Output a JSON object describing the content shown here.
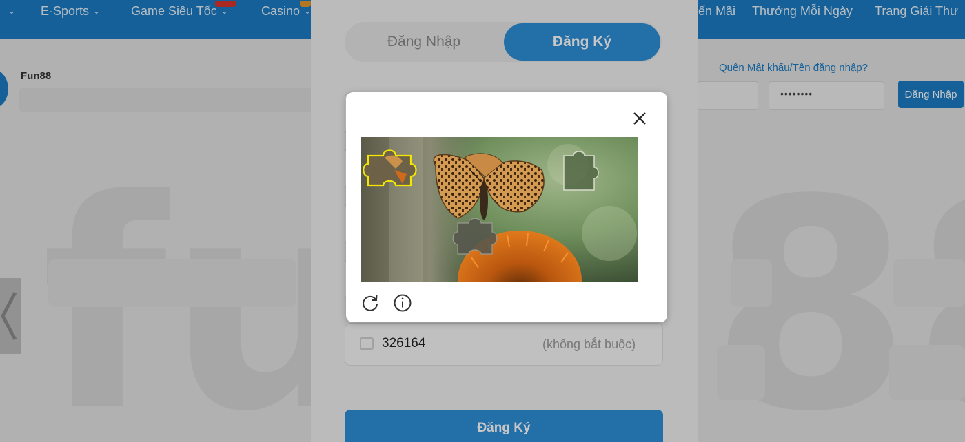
{
  "nav": {
    "items": [
      {
        "label": "o",
        "chevron": true
      },
      {
        "label": "E-Sports",
        "chevron": true
      },
      {
        "label": "Game Siêu Tốc",
        "chevron": true
      },
      {
        "label": "Casino",
        "chevron": true
      },
      {
        "label": "ến Mãi",
        "chevron": false
      },
      {
        "label": "Thưởng Mỗi Ngày",
        "chevron": false
      },
      {
        "label": "Trang Giải Thư",
        "chevron": false
      }
    ]
  },
  "background": {
    "brand": "Fun88",
    "forgot_link": "Quên Mật khẩu/Tên đăng nhập?",
    "password_mask": "••••••••",
    "login_button": "Đăng Nhập"
  },
  "register": {
    "tab_login": "Đăng Nhập",
    "tab_register": "Đăng Ký",
    "referral_code": "326164",
    "referral_optional": "(không bắt buộc)",
    "submit": "Đăng Ký"
  },
  "captcha": {
    "close_icon": "close-icon",
    "refresh_icon": "refresh-icon",
    "info_icon": "info-icon"
  },
  "colors": {
    "nav_bg": "#1c7cc4",
    "accent": "#2e8fd8",
    "piece_outline": "#f5e600"
  }
}
